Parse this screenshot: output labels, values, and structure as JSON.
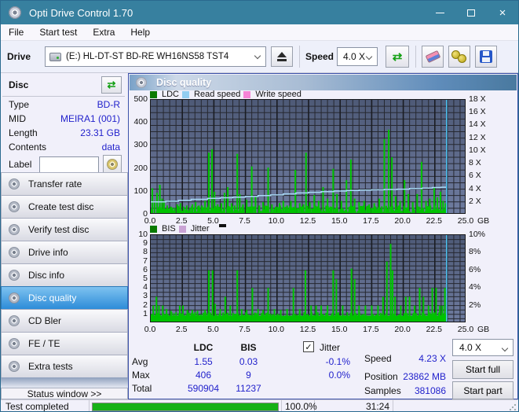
{
  "window": {
    "title": "Opti Drive Control 1.70"
  },
  "icons": {
    "refresh": "⇄",
    "close": "×",
    "check": "✓"
  },
  "menu": {
    "items": [
      "File",
      "Start test",
      "Extra",
      "Help"
    ]
  },
  "toolbar": {
    "drive_label": "Drive",
    "drive_value": "(E:)   HL-DT-ST BD-RE   WH16NS58 TST4",
    "speed_label": "Speed",
    "speed_value": "4.0 X"
  },
  "sidebar": {
    "disc_panel": {
      "title": "Disc",
      "fields": [
        {
          "label": "Type",
          "value": "BD-R"
        },
        {
          "label": "MID",
          "value": "MEIRA1 (001)"
        },
        {
          "label": "Length",
          "value": "23.31 GB"
        },
        {
          "label": "Contents",
          "value": "data"
        }
      ],
      "label_field": {
        "label": "Label",
        "value": ""
      }
    },
    "nav": [
      {
        "label": "Transfer rate",
        "selected": false
      },
      {
        "label": "Create test disc",
        "selected": false
      },
      {
        "label": "Verify test disc",
        "selected": false
      },
      {
        "label": "Drive info",
        "selected": false
      },
      {
        "label": "Disc info",
        "selected": false
      },
      {
        "label": "Disc quality",
        "selected": true
      },
      {
        "label": "CD Bler",
        "selected": false
      },
      {
        "label": "FE / TE",
        "selected": false
      },
      {
        "label": "Extra tests",
        "selected": false
      }
    ],
    "status_window_button": "Status window >>"
  },
  "main": {
    "header": "Disc quality"
  },
  "stats": {
    "col_headers": {
      "ldc": "LDC",
      "bis": "BIS",
      "jitter": "Jitter"
    },
    "jitter_checked": true,
    "rows": [
      {
        "label": "Avg",
        "ldc": "1.55",
        "bis": "0.03",
        "jitter": "-0.1%"
      },
      {
        "label": "Max",
        "ldc": "406",
        "bis": "9",
        "jitter": "0.0%"
      },
      {
        "label": "Total",
        "ldc": "590904",
        "bis": "11237",
        "jitter": ""
      }
    ],
    "right": [
      {
        "label": "Speed",
        "value": "4.23 X"
      },
      {
        "label": "Position",
        "value": "23862 MB"
      },
      {
        "label": "Samples",
        "value": "381086"
      }
    ],
    "speed_select": "4.0 X",
    "start_full": "Start full",
    "start_part": "Start part"
  },
  "statusbar": {
    "text": "Test completed",
    "progress_pct": 100,
    "progress_label": "100.0%",
    "time": "31:24"
  },
  "chart_data": [
    {
      "type": "bar",
      "name": "ldc-error-chart",
      "legend": [
        {
          "label": "LDC",
          "color": "#0a7a00"
        },
        {
          "label": "Read speed",
          "color": "#92cdf0"
        },
        {
          "label": "Write speed",
          "color": "#f583d6"
        }
      ],
      "xlim": [
        0,
        25
      ],
      "x_tick_labels": [
        "0.0",
        "2.5",
        "5.0",
        "7.5",
        "10.0",
        "12.5",
        "15.0",
        "17.5",
        "20.0",
        "22.5",
        "25.0"
      ],
      "x_unit": "GB",
      "left_axis": {
        "max": 500,
        "ticks": [
          0,
          100,
          200,
          300,
          400,
          500
        ]
      },
      "right_axis": {
        "max": 18,
        "ticks": [
          2,
          4,
          6,
          8,
          10,
          12,
          14,
          16,
          18
        ],
        "suffix": " X"
      },
      "h_divisions": 18,
      "v_minor_step_gb": 0.5,
      "v_major_step_gb": 2.5,
      "bar_color": "#00c300",
      "bars": [
        [
          0.12,
          115
        ],
        [
          0.3,
          60
        ],
        [
          0.5,
          95
        ],
        [
          0.72,
          130
        ],
        [
          0.9,
          70
        ],
        [
          1.05,
          60
        ],
        [
          1.3,
          40
        ],
        [
          1.6,
          35
        ],
        [
          1.9,
          30
        ],
        [
          2.1,
          45
        ],
        [
          2.35,
          50
        ],
        [
          2.6,
          35
        ],
        [
          2.85,
          40
        ],
        [
          3.1,
          30
        ],
        [
          3.3,
          45
        ],
        [
          3.55,
          55
        ],
        [
          3.8,
          35
        ],
        [
          4.05,
          40
        ],
        [
          4.3,
          60
        ],
        [
          4.6,
          270
        ],
        [
          4.85,
          285
        ],
        [
          5.05,
          100
        ],
        [
          5.3,
          45
        ],
        [
          5.6,
          50
        ],
        [
          5.85,
          95
        ],
        [
          6.1,
          120
        ],
        [
          6.4,
          50
        ],
        [
          6.65,
          40
        ],
        [
          6.85,
          265
        ],
        [
          7.05,
          90
        ],
        [
          7.3,
          45
        ],
        [
          7.6,
          65
        ],
        [
          8.0,
          210
        ],
        [
          8.3,
          80
        ],
        [
          8.6,
          40
        ],
        [
          8.9,
          55
        ],
        [
          9.3,
          205
        ],
        [
          9.6,
          45
        ],
        [
          9.9,
          35
        ],
        [
          10.2,
          50
        ],
        [
          10.5,
          60
        ],
        [
          10.8,
          40
        ],
        [
          11.1,
          60
        ],
        [
          11.45,
          195
        ],
        [
          11.8,
          50
        ],
        [
          12.1,
          45
        ],
        [
          12.3,
          270
        ],
        [
          12.6,
          55
        ],
        [
          12.95,
          85
        ],
        [
          13.3,
          60
        ],
        [
          13.65,
          120
        ],
        [
          14.0,
          70
        ],
        [
          14.45,
          200
        ],
        [
          14.75,
          90
        ],
        [
          15.1,
          60
        ],
        [
          15.5,
          150
        ],
        [
          15.85,
          240
        ],
        [
          16.15,
          70
        ],
        [
          16.5,
          55
        ],
        [
          16.9,
          60
        ],
        [
          17.3,
          45
        ],
        [
          17.7,
          50
        ],
        [
          18.1,
          70
        ],
        [
          18.5,
          330
        ],
        [
          18.85,
          370
        ],
        [
          19.1,
          250
        ],
        [
          19.4,
          80
        ],
        [
          19.75,
          60
        ],
        [
          20.1,
          150
        ],
        [
          20.4,
          90
        ],
        [
          20.75,
          55
        ],
        [
          21.1,
          90
        ],
        [
          21.45,
          230
        ],
        [
          21.8,
          60
        ],
        [
          22.1,
          70
        ],
        [
          22.45,
          120
        ],
        [
          22.7,
          75
        ],
        [
          22.95,
          100
        ],
        [
          23.15,
          60
        ],
        [
          23.35,
          50
        ]
      ],
      "baseline_noise": {
        "seed": 13,
        "step_gb": 0.07,
        "min": 4,
        "max": 40,
        "end_gb": 23.43
      },
      "line": {
        "color": "#a8d9f6",
        "axis": "right",
        "points": [
          [
            0,
            2.0
          ],
          [
            1.2,
            2.1
          ],
          [
            2.2,
            2.25
          ],
          [
            3.2,
            2.4
          ],
          [
            4.5,
            2.55
          ],
          [
            5.5,
            2.65
          ],
          [
            6.5,
            2.75
          ],
          [
            7.5,
            2.85
          ],
          [
            8.5,
            3.0
          ],
          [
            9.5,
            3.1
          ],
          [
            10.5,
            3.25
          ],
          [
            11.5,
            3.4
          ],
          [
            12.5,
            3.5
          ],
          [
            13.5,
            3.6
          ],
          [
            14.5,
            3.7
          ],
          [
            15.5,
            3.78
          ],
          [
            16.5,
            3.85
          ],
          [
            17.5,
            3.9
          ],
          [
            18.5,
            3.95
          ],
          [
            19.5,
            4.0
          ],
          [
            20.5,
            4.1
          ],
          [
            21.5,
            4.15
          ],
          [
            22.3,
            4.25
          ],
          [
            23.0,
            4.3
          ],
          [
            23.43,
            4.3
          ]
        ]
      },
      "marker_gb": 23.43,
      "marker_color": "#4fc4f4"
    },
    {
      "type": "bar",
      "name": "bis-jitter-chart",
      "legend": [
        {
          "label": "BIS",
          "color": "#0a7a00"
        },
        {
          "label": "Jitter",
          "color": "#c9a3d4"
        }
      ],
      "legend_extra_marker": true,
      "xlim": [
        0,
        25
      ],
      "x_tick_labels": [
        "0.0",
        "2.5",
        "5.0",
        "7.5",
        "10.0",
        "12.5",
        "15.0",
        "17.5",
        "20.0",
        "22.5",
        "25.0"
      ],
      "x_unit": "GB",
      "left_axis": {
        "max": 10,
        "ticks": [
          1,
          2,
          3,
          4,
          5,
          6,
          7,
          8,
          9,
          10
        ]
      },
      "right_axis": {
        "max": 10,
        "ticks": [
          2,
          4,
          6,
          8,
          10
        ],
        "suffix": "%"
      },
      "h_divisions": 20,
      "v_minor_step_gb": 0.5,
      "v_major_step_gb": 2.5,
      "bar_color": "#00c300",
      "bars": [
        [
          0.2,
          2
        ],
        [
          0.45,
          3
        ],
        [
          0.65,
          2
        ],
        [
          0.95,
          2
        ],
        [
          1.25,
          1.6
        ],
        [
          1.6,
          1.4
        ],
        [
          2.3,
          2
        ],
        [
          2.55,
          2
        ],
        [
          2.9,
          1.5
        ],
        [
          3.3,
          1.5
        ],
        [
          3.7,
          1.4
        ],
        [
          4.3,
          1.5
        ],
        [
          4.6,
          6
        ],
        [
          4.9,
          6
        ],
        [
          5.1,
          2.2
        ],
        [
          5.5,
          1.6
        ],
        [
          5.9,
          3
        ],
        [
          6.3,
          2
        ],
        [
          6.85,
          6
        ],
        [
          7.2,
          1.6
        ],
        [
          7.6,
          1.5
        ],
        [
          8.05,
          4
        ],
        [
          8.5,
          1.6
        ],
        [
          8.9,
          1.5
        ],
        [
          9.3,
          4
        ],
        [
          9.8,
          1.6
        ],
        [
          10.3,
          1.5
        ],
        [
          10.8,
          1.6
        ],
        [
          11.3,
          4
        ],
        [
          11.8,
          1.6
        ],
        [
          12.25,
          6
        ],
        [
          12.7,
          2
        ],
        [
          13.1,
          2
        ],
        [
          13.5,
          2
        ],
        [
          14.0,
          2
        ],
        [
          14.45,
          6
        ],
        [
          14.7,
          5
        ],
        [
          15.2,
          2
        ],
        [
          15.9,
          6.2
        ],
        [
          16.15,
          5
        ],
        [
          16.5,
          2
        ],
        [
          17.0,
          2
        ],
        [
          17.5,
          2
        ],
        [
          18.0,
          2
        ],
        [
          18.4,
          3
        ],
        [
          18.7,
          7
        ],
        [
          19.0,
          9
        ],
        [
          19.15,
          6
        ],
        [
          19.35,
          3
        ],
        [
          19.8,
          2
        ],
        [
          20.2,
          3
        ],
        [
          20.5,
          3
        ],
        [
          20.9,
          2
        ],
        [
          21.3,
          4
        ],
        [
          21.6,
          3
        ],
        [
          22.0,
          2
        ],
        [
          22.3,
          4
        ],
        [
          22.6,
          4
        ],
        [
          22.9,
          2
        ],
        [
          23.1,
          2
        ],
        [
          23.3,
          4
        ]
      ],
      "baseline_fill": {
        "height": 0.85,
        "end_gb": 23.43
      },
      "baseline_noise": {
        "seed": 5,
        "step_gb": 0.06,
        "min": 0.3,
        "max": 1.25,
        "end_gb": 23.43
      },
      "jitter_line": {
        "color": "#f0a8d8",
        "value": 0.1
      },
      "marker_gb": 23.43,
      "marker_color": "#4fc4f4"
    }
  ]
}
